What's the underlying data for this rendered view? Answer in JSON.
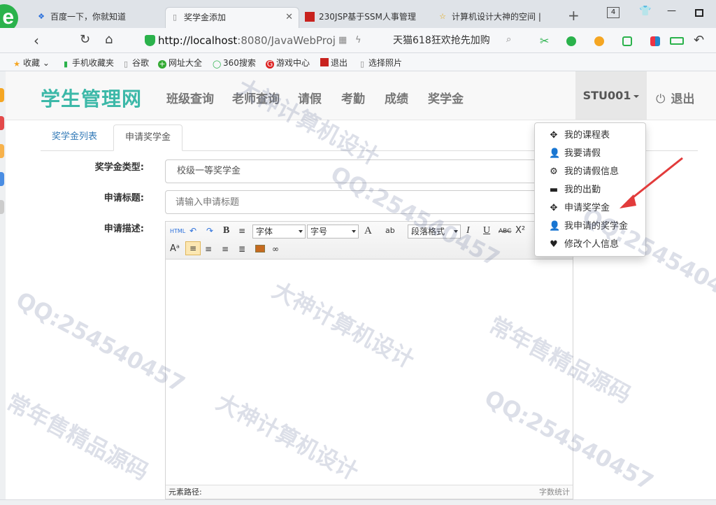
{
  "browser": {
    "tabs": [
      {
        "label": "百度一下，你就知道",
        "icon": "paw"
      },
      {
        "label": "奖学金添加",
        "icon": "page",
        "close": "✕"
      },
      {
        "label": "230JSP基于SSM人事管理",
        "icon": "red-square"
      },
      {
        "label": "计算机设计大神的空间 |",
        "icon": "star"
      }
    ],
    "new_tab": "+",
    "tab_count": "4",
    "url_host": "http://localhost",
    "url_rest": ":8080/JavaWebProj",
    "search_text": "天猫618狂欢抢先加购",
    "bookmarks": [
      {
        "label": "收藏",
        "icon": "star"
      },
      {
        "label": "手机收藏夹",
        "icon": "phone"
      },
      {
        "label": "谷歌",
        "icon": "page"
      },
      {
        "label": "网址大全",
        "icon": "globe"
      },
      {
        "label": "360搜索",
        "icon": "search"
      },
      {
        "label": "游戏中心",
        "icon": "game"
      },
      {
        "label": "退出",
        "icon": "exit"
      },
      {
        "label": "选择照片",
        "icon": "page"
      }
    ]
  },
  "app": {
    "brand": "学生管理网",
    "nav": [
      "班级查询",
      "老师查询",
      "请假",
      "考勤",
      "成绩",
      "奖学金"
    ],
    "user": "STU001",
    "logout": "退出",
    "content_tabs": [
      "奖学金列表",
      "申请奖学金"
    ],
    "form": {
      "type_label": "奖学金类型:",
      "type_value": "校级一等奖学金",
      "title_label": "申请标题:",
      "title_placeholder": "请输入申请标题",
      "desc_label": "申请描述:"
    },
    "editor": {
      "font_label": "字体",
      "size_label": "字号",
      "para_label": "段落格式",
      "path_label": "元素路径:",
      "count_label": "字数统计"
    },
    "user_menu": [
      {
        "label": "我的课程表",
        "icon": "move-icon"
      },
      {
        "label": "我要请假",
        "icon": "user-icon"
      },
      {
        "label": "我的请假信息",
        "icon": "gear-icon"
      },
      {
        "label": "我的出勤",
        "icon": "card-icon"
      },
      {
        "label": "申请奖学金",
        "icon": "move-icon"
      },
      {
        "label": "我申请的奖学金",
        "icon": "user-icon"
      },
      {
        "label": "修改个人信息",
        "icon": "heart-icon"
      }
    ]
  },
  "watermarks": [
    "QQ:254540457",
    "常年售精品源码",
    "大神计算机设计"
  ],
  "colors": {
    "brand": "#3cb8a8",
    "arrow": "#e23b3b"
  }
}
